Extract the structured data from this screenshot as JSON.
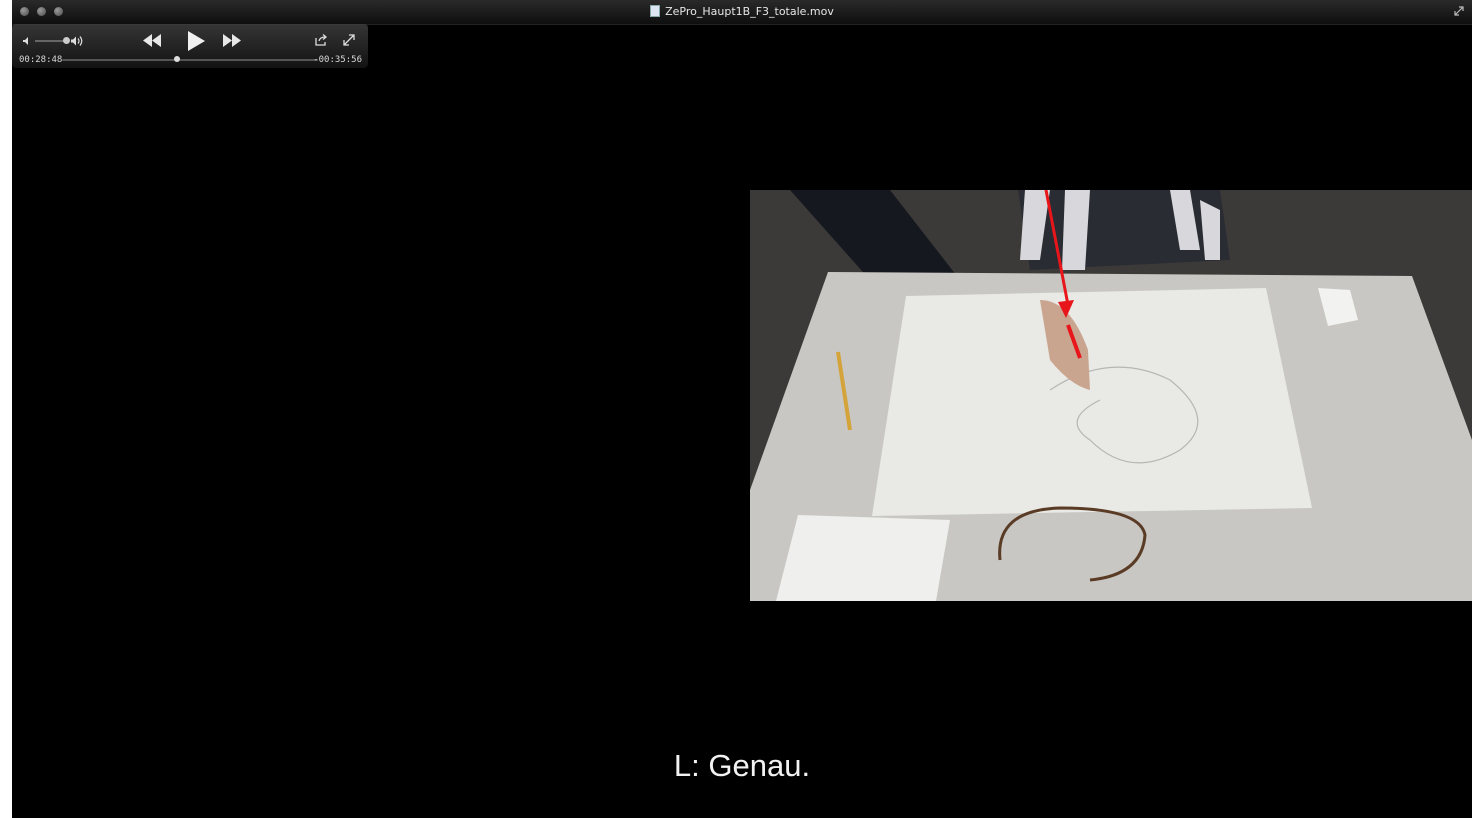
{
  "window": {
    "title": "ZePro_Haupt1B_F3_totale.mov"
  },
  "hud": {
    "elapsed": "00:28:48",
    "remaining": "-00:35:56",
    "progress_fraction": 0.45,
    "buttons": {
      "volume_min": "volume-low-icon",
      "volume_max": "volume-high-icon",
      "rewind": "rewind-icon",
      "play": "play-icon",
      "fast_forward": "fast-forward-icon",
      "share": "share-icon",
      "fullscreen": "fullscreen-icon"
    }
  },
  "subtitle": "L: Genau.",
  "colors": {
    "background": "#000000",
    "annotation_arrow": "#e8151a"
  }
}
